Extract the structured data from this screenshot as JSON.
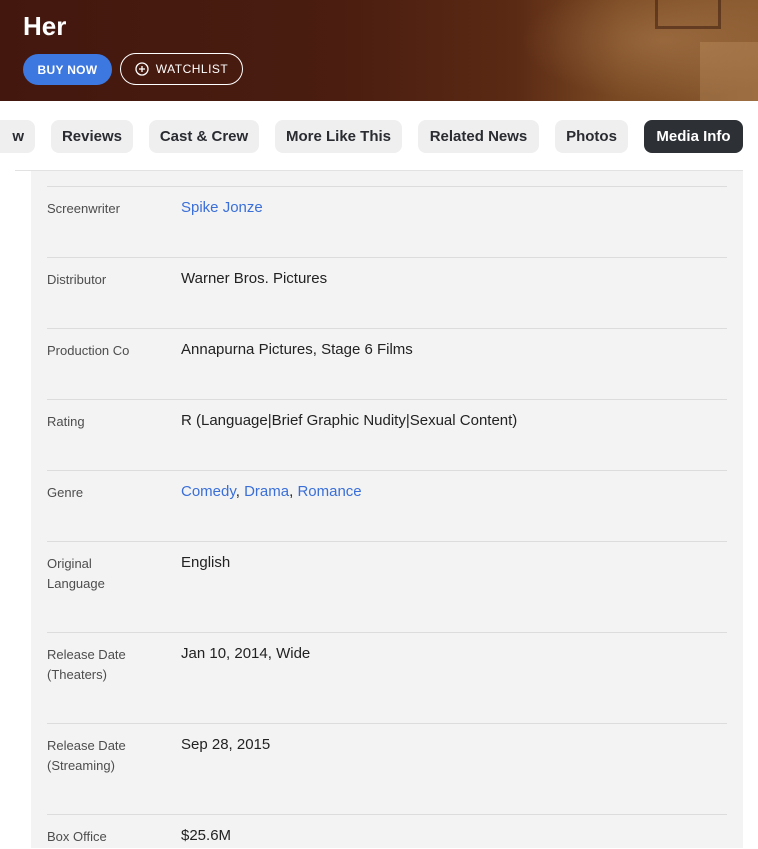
{
  "header": {
    "title": "Her",
    "buy_label": "BUY NOW",
    "watchlist_label": "WATCHLIST"
  },
  "tabs": [
    {
      "label": "w",
      "active": false
    },
    {
      "label": "Reviews",
      "active": false
    },
    {
      "label": "Cast & Crew",
      "active": false
    },
    {
      "label": "More Like This",
      "active": false
    },
    {
      "label": "Related News",
      "active": false
    },
    {
      "label": "Photos",
      "active": false
    },
    {
      "label": "Media Info",
      "active": true
    }
  ],
  "media_info": {
    "screenwriter": {
      "label": "Screenwriter",
      "value": "Spike Jonze"
    },
    "distributor": {
      "label": "Distributor",
      "value": "Warner Bros. Pictures"
    },
    "production": {
      "label": "Production Co",
      "value": "Annapurna Pictures, Stage 6 Films"
    },
    "rating": {
      "label": "Rating",
      "value": "R (Language|Brief Graphic Nudity|Sexual Content)"
    },
    "genre": {
      "label": "Genre",
      "values": [
        "Comedy",
        "Drama",
        "Romance"
      ],
      "separator": ", "
    },
    "language": {
      "label_line1": "Original",
      "label_line2": "Language",
      "value": "English"
    },
    "release_theaters": {
      "label_line1": "Release Date",
      "label_line2": "(Theaters)",
      "value": "Jan 10, 2014, Wide"
    },
    "release_streaming": {
      "label_line1": "Release Date",
      "label_line2": "(Streaming)",
      "value": "Sep 28, 2015"
    },
    "box_office": {
      "label": "Box Office",
      "value": "$25.6M"
    }
  },
  "colors": {
    "accent_blue": "#3d77e0",
    "link": "#3a6fd8",
    "active_tab": "#2d3136"
  }
}
